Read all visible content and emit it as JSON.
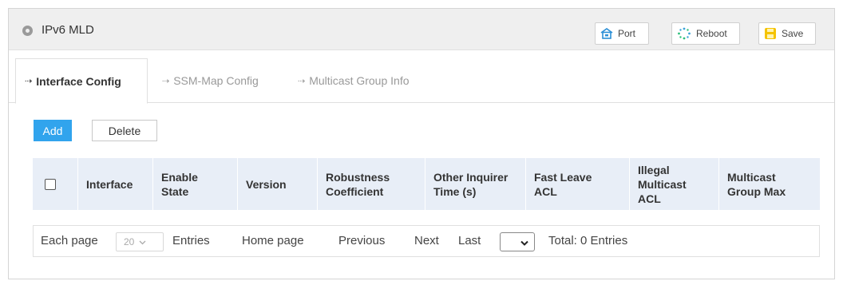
{
  "window": {
    "title": "IPv6 MLD",
    "title_icon": "radio-circle-icon",
    "buttons": [
      {
        "label": "Port",
        "icon": "port-icon"
      },
      {
        "label": "Reboot",
        "icon": "reboot-icon"
      },
      {
        "label": "Save",
        "icon": "save-icon"
      }
    ]
  },
  "tabs": [
    {
      "label": "Interface Config",
      "active": true
    },
    {
      "label": "SSM-Map Config",
      "active": false
    },
    {
      "label": "Multicast Group Info",
      "active": false
    }
  ],
  "actions": {
    "add_label": "Add",
    "delete_label": "Delete"
  },
  "table": {
    "columns": [
      [
        "Interface"
      ],
      [
        "Enable",
        "State"
      ],
      [
        "Version"
      ],
      [
        "Robustness",
        "Coefficient"
      ],
      [
        "Other Inquirer",
        "Time (s)"
      ],
      [
        "Fast Leave",
        "ACL"
      ],
      [
        "Illegal",
        "Multicast",
        "ACL"
      ],
      [
        "Multicast",
        "Group Max"
      ]
    ],
    "rows": []
  },
  "pagination": {
    "each_page_label": "Each page",
    "per_page_value": "20",
    "entries_label": "Entries",
    "home_label": "Home page",
    "previous_label": "Previous",
    "next_label": "Next",
    "last_label": "Last",
    "page_value": "",
    "total_label": "Total: 0 Entries"
  },
  "colors": {
    "accent": "#31a4ed",
    "header_bg": "#e8eef7",
    "titlebar_bg": "#efefef",
    "save_icon": "#f5c300",
    "port_icon": "#2b8fd6",
    "reboot_icon": "#3aa3d8"
  }
}
